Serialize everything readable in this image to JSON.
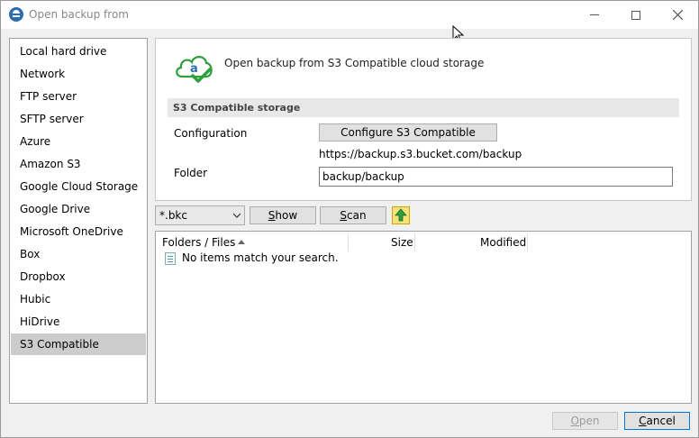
{
  "window": {
    "title": "Open backup from"
  },
  "sidebar": {
    "items": [
      {
        "label": "Local hard drive"
      },
      {
        "label": "Network"
      },
      {
        "label": "FTP server"
      },
      {
        "label": "SFTP server"
      },
      {
        "label": "Azure"
      },
      {
        "label": "Amazon S3"
      },
      {
        "label": "Google Cloud Storage"
      },
      {
        "label": "Google Drive"
      },
      {
        "label": "Microsoft OneDrive"
      },
      {
        "label": "Box"
      },
      {
        "label": "Dropbox"
      },
      {
        "label": "Hubic"
      },
      {
        "label": "HiDrive"
      },
      {
        "label": "S3 Compatible"
      }
    ],
    "selected": "S3 Compatible"
  },
  "panel": {
    "heading": "Open backup from S3 Compatible cloud storage",
    "group_title": "S3 Compatible storage",
    "configuration_label": "Configuration",
    "configure_button": "Configure S3 Compatible",
    "url": "https://backup.s3.bucket.com/backup",
    "folder_label": "Folder",
    "folder_value": "backup/backup"
  },
  "toolbar": {
    "filter_value": "*.bkc",
    "show_label_first": "S",
    "show_label_rest": "how",
    "scan_label_first": "S",
    "scan_label_rest": "can"
  },
  "file_list": {
    "columns": [
      "Folders / Files",
      "Size",
      "Modified"
    ],
    "empty_message": "No items match your search."
  },
  "footer": {
    "open_label_first": "O",
    "open_label_rest": "pen",
    "cancel_label_first": "C",
    "cancel_label_rest": "ancel"
  },
  "colors": {
    "selected_bg": "#cccccc",
    "accent": "#0078d7",
    "cloud_green": "#2e9e3f",
    "logo_blue": "#2a6db0"
  }
}
